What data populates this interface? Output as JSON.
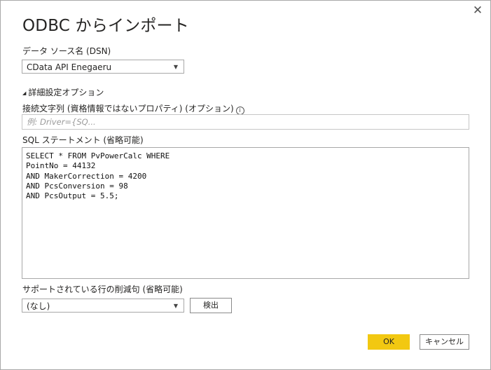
{
  "dialog": {
    "title": "ODBC からインポート",
    "close_glyph": "✕"
  },
  "dsn": {
    "label": "データ ソース名 (DSN)",
    "value": "CData API Enegaeru"
  },
  "advanced": {
    "toggle_label": "詳細設定オプション",
    "connection_string": {
      "label": "接続文字列 (資格情報ではないプロパティ) (オプション)",
      "placeholder": "例: Driver={SQ..."
    },
    "sql": {
      "label": "SQL ステートメント (省略可能)",
      "lines": [
        "SELECT * FROM PvPowerCalc WHERE",
        "PointNo = 44132",
        "AND MakerCorrection = 4200",
        "AND PcsConversion = 98",
        "AND PcsOutput = 5.5;"
      ]
    },
    "row_reduction": {
      "label": "サポートされている行の削減句 (省略可能)",
      "value": "(なし)",
      "detect_label": "検出"
    }
  },
  "footer": {
    "ok_label": "OK",
    "cancel_label": "キャンセル"
  },
  "colors": {
    "accent": "#f2c811",
    "border": "#a8a8a8"
  }
}
